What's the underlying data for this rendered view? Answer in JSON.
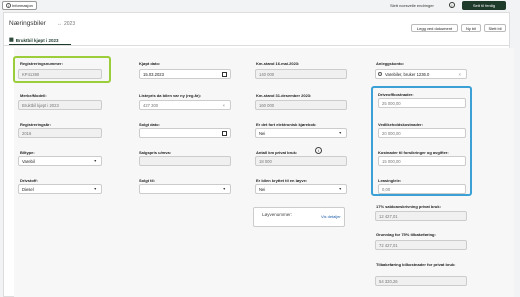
{
  "topbar": {
    "info_label": "Informasjon",
    "discard_label": "Slett ncesvelle endringer",
    "save_label": "Sett til ferdig"
  },
  "header": {
    "title": "Næringsbiler",
    "year": "2023",
    "buttons": [
      "Legg ved dokument",
      "Ny bil",
      "Slett bil"
    ]
  },
  "tab": {
    "label": "Bruktbil kjøpt i 2023"
  },
  "fields": {
    "reg_nr": {
      "label": "Registreringsnummer:",
      "value": "KP41390"
    },
    "merke": {
      "label": "Merke/Modell:",
      "value": "Bruktbil kjøpt i 2023"
    },
    "reg_aar": {
      "label": "Registreringsår:",
      "value": "2016"
    },
    "biltype": {
      "label": "Biltype:",
      "value": "Varebil"
    },
    "drivstoff": {
      "label": "Drivstoff:",
      "value": "Diesel"
    },
    "kjopt_dato": {
      "label": "Kjøpt dato:",
      "value": "15.03.2023"
    },
    "listepris": {
      "label": "Listepris da bilen var ny (reg.år):",
      "value": "427 300"
    },
    "solgt_dato": {
      "label": "Solgt dato:",
      "value": ""
    },
    "salgspris": {
      "label": "Salgspris u/mva:",
      "value": ""
    },
    "solgt_til": {
      "label": "Solgt til:",
      "value": ""
    },
    "km_start": {
      "label": "Km-stand 16.mai.2023:",
      "value": "140 000"
    },
    "km_slutt": {
      "label": "Km-stand 31.desember 2023:",
      "value": "160 000"
    },
    "elektrisk": {
      "label": "Er det fort elektronisk kjørebok:",
      "value": "Nei"
    },
    "privat_km": {
      "label": "Antall km privat bruk:",
      "value": "18 000"
    },
    "leiet": {
      "label": "Er bilen kryttet til en løyve:",
      "value": "Nei"
    },
    "loyve": {
      "label": "Løyvenummer:",
      "link": "Vis detaljer"
    },
    "konto": {
      "label": "Anleggskonto:",
      "value": "Varebiler, bruker 1236.0"
    },
    "drift": {
      "label": "Driveoffkostnader:",
      "value": "25 000,00"
    },
    "vedlikehold": {
      "label": "Vedlikeholdskostnader:",
      "value": "20 000,00"
    },
    "forsikring": {
      "label": "Kostnader til forsikringer og avgifter:",
      "value": "15 000,00"
    },
    "leasing": {
      "label": "Leasingleie:",
      "value": "0,00"
    },
    "saldo": {
      "label": "17% saldoavskrivning privat bruk:",
      "value": "12 427,01"
    },
    "grunnlag": {
      "label": "Grunnlag for 75% tilbakeføring:",
      "value": "72 427,01"
    },
    "tilbake": {
      "label": "Tilbakeføring bilkostnader for privat bruk:",
      "value": "54 320,26"
    }
  },
  "colors": {
    "highlight_green": "#9ccd3b",
    "highlight_blue": "#3aa0d6",
    "primary": "#1d3a2b",
    "link": "#1f5fa8"
  }
}
